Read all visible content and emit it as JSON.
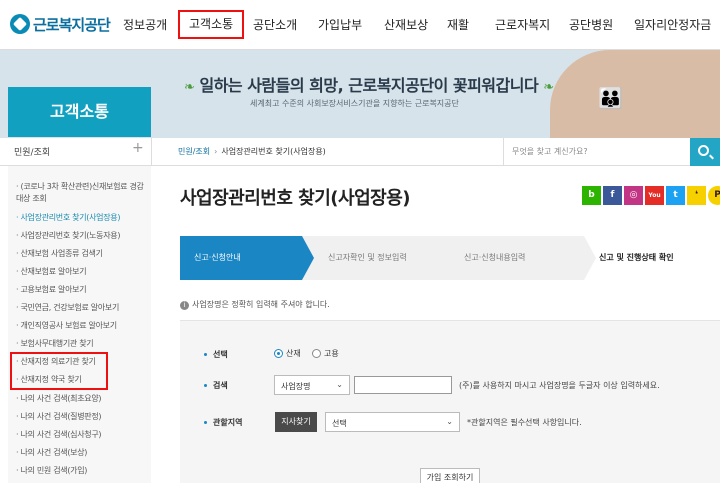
{
  "logo": {
    "text": "근로복지공단"
  },
  "nav": [
    {
      "label": "정보공개"
    },
    {
      "label": "고객소통"
    },
    {
      "label": "공단소개"
    },
    {
      "label": "가입납부"
    },
    {
      "label": "산재보상"
    },
    {
      "label": "재활"
    },
    {
      "label": "근로자복지"
    },
    {
      "label": "공단병원"
    },
    {
      "label": "일자리안정자금"
    }
  ],
  "banner": {
    "slogan": "일하는 사람들의 희망, 근로복지공단이 꽃피워갑니다",
    "sub": "세계최고 수준의 사회보장서비스기관을 지향하는 근로복지공단"
  },
  "side_header": "고객소통",
  "side_section": "민원/조회",
  "breadcrumb": [
    "민원/조회",
    "사업장관리번호 찾기(사업장용)"
  ],
  "search": {
    "placeholder": "무엇을 찾고 계신가요?"
  },
  "sidebar_items": [
    "(코로나 3차 확산관련)신재보험료 경감 대상 조회",
    "사업장관리번호 찾기(사업장용)",
    "사업장관리번호 찾기(노동자용)",
    "산재보험 사업종류 검색기",
    "산재보험료 알아보기",
    "고용보험료 알아보기",
    "국민연금, 건강보험료 알아보기",
    "개인직영공사 보험료 알아보기",
    "보험사무대행기관 찾기",
    "산재지정 의료기관 찾기",
    "산재지정 약국 찾기",
    "나의 사건 검색(최초요양)",
    "나의 사건 검색(질병판정)",
    "나의 사건 검색(심사청구)",
    "나의 사건 검색(보상)",
    "나의 민원 검색(가입)"
  ],
  "page_title": "사업장관리번호 찾기(사업장용)",
  "sns": {
    "b": "b",
    "f": "f",
    "ig": "◎",
    "yt": "You",
    "t": "t",
    "k": "❛",
    "p": "P"
  },
  "steps": [
    "신고·신청안내",
    "신고자확인 및 정보입력",
    "신고·신청내용입력",
    "신고 및 진행상태 확인"
  ],
  "notice": "사업장명은 정확히 입력해 주셔야 합니다.",
  "form": {
    "choice_label": "선택",
    "radio1": "산재",
    "radio2": "고용",
    "search_label": "검색",
    "search_select": "사업장명",
    "search_hint": "(주)를 사용하지 마시고 사업장명을 두글자 이상 입력하세요.",
    "region_label": "관할지역",
    "branch_button": "지사찾기",
    "region_select": "선택",
    "region_hint": "*관할지역은 필수선택 사항입니다.",
    "submit_button": "가입 조회하기"
  }
}
